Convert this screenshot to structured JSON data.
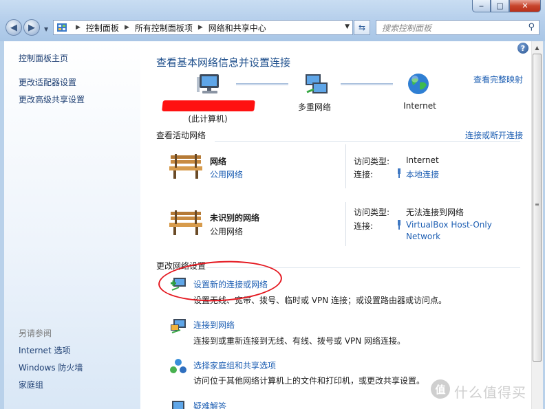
{
  "window": {
    "minimize": "‒",
    "maximize": "□",
    "close": "✕"
  },
  "toolbar": {
    "breadcrumbs": [
      "控制面板",
      "所有控制面板项",
      "网络和共享中心"
    ],
    "search_placeholder": "搜索控制面板"
  },
  "sidebar": {
    "links": [
      "控制面板主页",
      "更改适配器设置",
      "更改高级共享设置"
    ],
    "see_also_title": "另请参阅",
    "see_also": [
      "Internet 选项",
      "Windows 防火墙",
      "家庭组"
    ]
  },
  "main": {
    "title": "查看基本网络信息并设置连接",
    "map_link": "查看完整映射",
    "map": {
      "this_computer": "(此计算机)",
      "multiple_networks": "多重网络",
      "internet": "Internet"
    },
    "active_networks_label": "查看活动网络",
    "connect_disconnect_link": "连接或断开连接",
    "networks": [
      {
        "name": "网络",
        "type": "公用网络",
        "type_is_link": true,
        "access_key": "访问类型:",
        "access_value": "Internet",
        "conn_key": "连接:",
        "conn_value": "本地连接"
      },
      {
        "name": "未识别的网络",
        "type": "公用网络",
        "type_is_link": false,
        "access_key": "访问类型:",
        "access_value": "无法连接到网络",
        "conn_key": "连接:",
        "conn_value_line1": "VirtualBox Host-Only",
        "conn_value_line2": "Network"
      }
    ],
    "change_settings_label": "更改网络设置",
    "tasks": [
      {
        "link": "设置新的连接或网络",
        "desc": "设置无线、宽带、拨号、临时或 VPN 连接；或设置路由器或访问点。"
      },
      {
        "link": "连接到网络",
        "desc": "连接到或重新连接到无线、有线、拨号或 VPN 网络连接。"
      },
      {
        "link": "选择家庭组和共享选项",
        "desc": "访问位于其他网络计算机上的文件和打印机，或更改共享设置。"
      },
      {
        "link": "疑难解答"
      }
    ]
  },
  "watermark": {
    "badge": "值",
    "text": "什么值得买"
  },
  "colors": {
    "link": "#1e5fb3",
    "title": "#1e4f8c",
    "annotation": "#e4161e"
  }
}
